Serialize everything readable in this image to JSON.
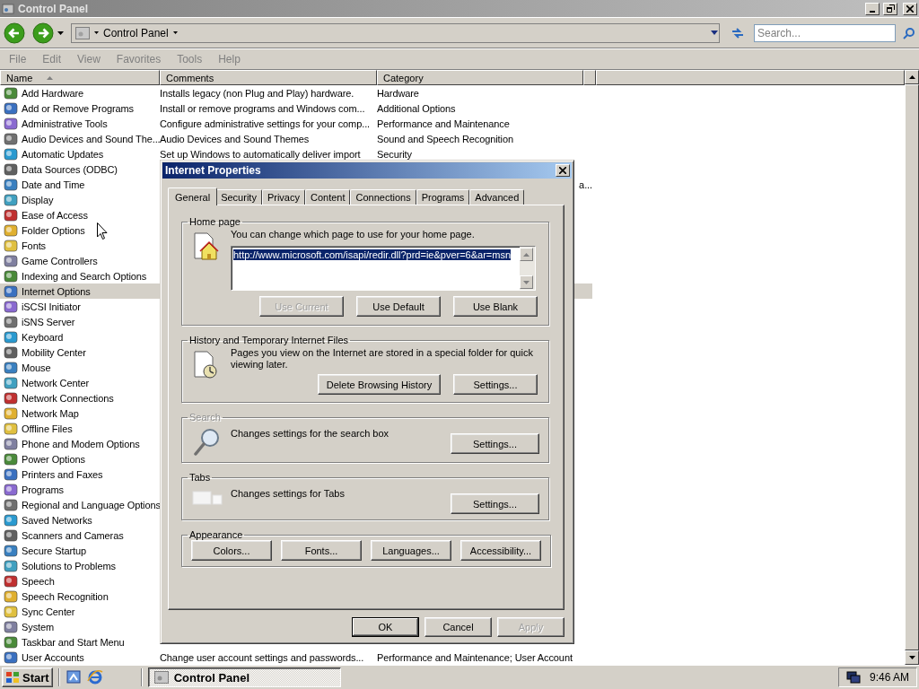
{
  "window": {
    "title": "Control Panel"
  },
  "toolbar": {
    "address": "Control Panel",
    "search": {
      "placeholder": "Search..."
    }
  },
  "menu": [
    "File",
    "Edit",
    "View",
    "Favorites",
    "Tools",
    "Help"
  ],
  "list": {
    "columns": [
      {
        "label": "Name",
        "sorted": true
      },
      {
        "label": "Comments",
        "sorted": false
      },
      {
        "label": "Category",
        "sorted": false
      }
    ],
    "rows": [
      {
        "name": "Add Hardware",
        "comment": "Installs legacy (non Plug and Play) hardware.",
        "category": "Hardware",
        "selected": false
      },
      {
        "name": "Add or Remove Programs",
        "comment": "Install or remove programs and Windows com...",
        "category": "Additional Options",
        "selected": false
      },
      {
        "name": "Administrative Tools",
        "comment": "Configure administrative settings for your comp...",
        "category": "Performance and Maintenance",
        "selected": false
      },
      {
        "name": "Audio Devices and Sound The...",
        "comment": "Audio Devices and Sound Themes",
        "category": "Sound and Speech Recognition",
        "selected": false
      },
      {
        "name": "Automatic Updates",
        "comment": "Set up Windows to automatically deliver import",
        "category": "Security",
        "selected": false
      },
      {
        "name": "Data Sources (ODBC)",
        "selected": false
      },
      {
        "name": "Date and Time",
        "category": "a...",
        "selected": false
      },
      {
        "name": "Display",
        "selected": false
      },
      {
        "name": "Ease of Access",
        "selected": false
      },
      {
        "name": "Folder Options",
        "selected": false
      },
      {
        "name": "Fonts",
        "selected": false
      },
      {
        "name": "Game Controllers",
        "selected": false
      },
      {
        "name": "Indexing and Search Options",
        "selected": false
      },
      {
        "name": "Internet Options",
        "selected": true
      },
      {
        "name": "iSCSI Initiator",
        "selected": false
      },
      {
        "name": "iSNS Server",
        "selected": false
      },
      {
        "name": "Keyboard",
        "selected": false
      },
      {
        "name": "Mobility Center",
        "selected": false
      },
      {
        "name": "Mouse",
        "selected": false
      },
      {
        "name": "Network Center",
        "selected": false
      },
      {
        "name": "Network Connections",
        "selected": false
      },
      {
        "name": "Network Map",
        "selected": false
      },
      {
        "name": "Offline Files",
        "selected": false
      },
      {
        "name": "Phone and Modem Options",
        "selected": false
      },
      {
        "name": "Power Options",
        "selected": false
      },
      {
        "name": "Printers and Faxes",
        "selected": false
      },
      {
        "name": "Programs",
        "selected": false
      },
      {
        "name": "Regional and Language Options",
        "selected": false
      },
      {
        "name": "Saved Networks",
        "selected": false
      },
      {
        "name": "Scanners and Cameras",
        "selected": false
      },
      {
        "name": "Secure Startup",
        "selected": false
      },
      {
        "name": "Solutions to Problems",
        "selected": false
      },
      {
        "name": "Speech",
        "selected": false
      },
      {
        "name": "Speech Recognition",
        "selected": false
      },
      {
        "name": "Sync Center",
        "selected": false
      },
      {
        "name": "System",
        "selected": false
      },
      {
        "name": "Taskbar and Start Menu",
        "selected": false
      },
      {
        "name": "User Accounts",
        "comment": "Change user account settings and passwords...",
        "category": "Performance and Maintenance; User Account",
        "selected": false
      }
    ]
  },
  "dialog": {
    "title": "Internet Properties",
    "tabs": [
      {
        "label": "General",
        "selected": true
      },
      {
        "label": "Security",
        "selected": false
      },
      {
        "label": "Privacy",
        "selected": false
      },
      {
        "label": "Content",
        "selected": false
      },
      {
        "label": "Connections",
        "selected": false
      },
      {
        "label": "Programs",
        "selected": false
      },
      {
        "label": "Advanced",
        "selected": false
      }
    ],
    "groups": [
      {
        "kind": "homepage",
        "title": "Home page",
        "disabled": false,
        "text": "You can change which page to use for your home page.",
        "url": {
          "value": "http://www.microsoft.com/isapi/redir.dll?prd=ie&pver=6&ar=msn",
          "selected": true
        },
        "buttons": [
          {
            "label": "Use Current",
            "disabled": true
          },
          {
            "label": "Use Default",
            "disabled": false
          },
          {
            "label": "Use Blank",
            "disabled": false
          }
        ]
      },
      {
        "kind": "history",
        "title": "History and Temporary Internet Files",
        "disabled": false,
        "text": "Pages you view on the Internet are stored in a special folder for quick viewing later.",
        "buttons": [
          {
            "label": "Delete Browsing History",
            "disabled": false
          },
          {
            "label": "Settings...",
            "disabled": false
          }
        ]
      },
      {
        "kind": "search",
        "title": "Search",
        "disabled": true,
        "text": "Changes settings for the search box",
        "buttons": [
          {
            "label": "Settings...",
            "disabled": false
          }
        ]
      },
      {
        "kind": "tabs",
        "title": "Tabs",
        "disabled": false,
        "text": "Changes settings for Tabs",
        "buttons": [
          {
            "label": "Settings...",
            "disabled": false
          }
        ]
      },
      {
        "kind": "appearance",
        "title": "Appearance",
        "disabled": false,
        "buttons": [
          {
            "label": "Colors...",
            "disabled": false
          },
          {
            "label": "Fonts...",
            "disabled": false
          },
          {
            "label": "Languages...",
            "disabled": false
          },
          {
            "label": "Accessibility...",
            "disabled": false
          }
        ]
      }
    ],
    "buttons": [
      {
        "label": "OK",
        "default": true,
        "disabled": false
      },
      {
        "label": "Cancel",
        "default": false,
        "disabled": false
      },
      {
        "label": "Apply",
        "default": false,
        "disabled": true
      }
    ]
  },
  "taskbar": {
    "start": "Start",
    "tasks": [
      {
        "label": "Control Panel",
        "selected": true
      }
    ],
    "clock": "9:46 AM"
  }
}
